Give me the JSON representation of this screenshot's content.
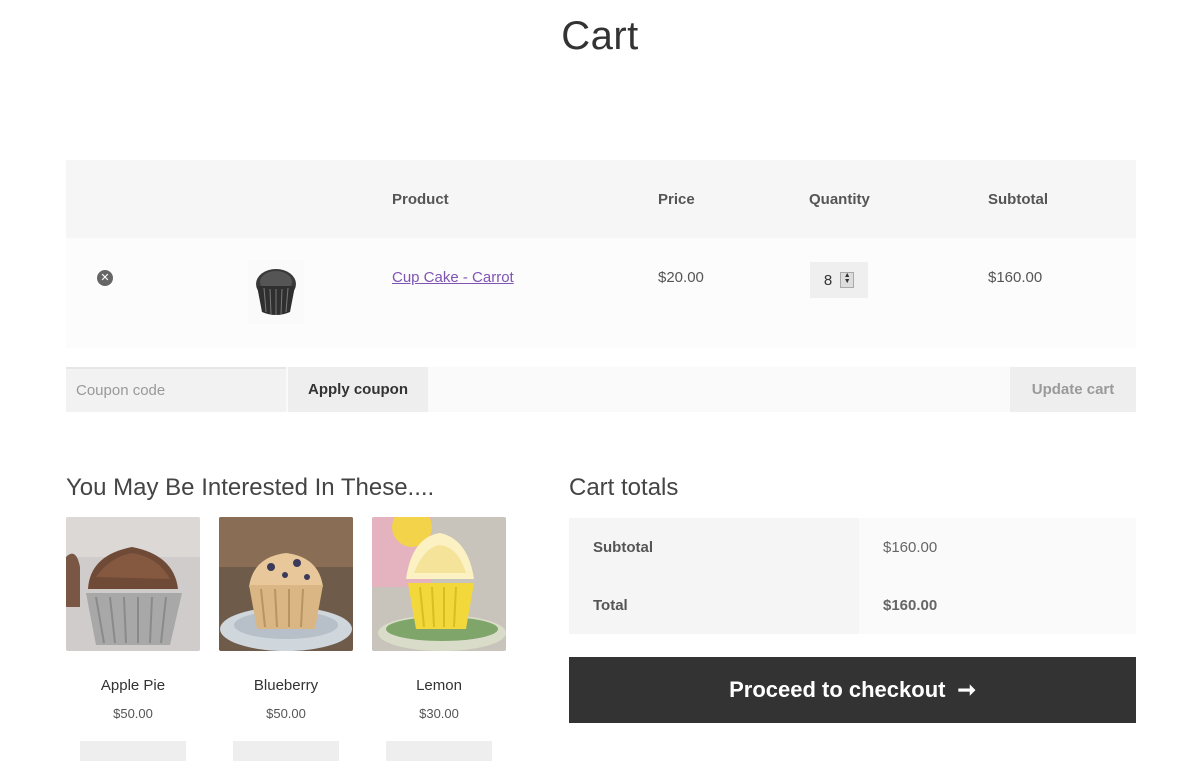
{
  "page": {
    "title": "Cart"
  },
  "cart_table": {
    "headers": {
      "product": "Product",
      "price": "Price",
      "quantity": "Quantity",
      "subtotal": "Subtotal"
    },
    "items": [
      {
        "name": "Cup Cake - Carrot",
        "price": "$20.00",
        "quantity": "8",
        "subtotal": "$160.00"
      }
    ]
  },
  "actions": {
    "coupon_placeholder": "Coupon code",
    "apply_coupon_label": "Apply coupon",
    "update_cart_label": "Update cart"
  },
  "cross_sells": {
    "title": "You May Be Interested In These....",
    "items": [
      {
        "name": "Apple Pie",
        "price": "$50.00"
      },
      {
        "name": "Blueberry",
        "price": "$50.00"
      },
      {
        "name": "Lemon",
        "price": "$30.00"
      }
    ]
  },
  "cart_totals": {
    "title": "Cart totals",
    "subtotal_label": "Subtotal",
    "subtotal_value": "$160.00",
    "total_label": "Total",
    "total_value": "$160.00",
    "checkout_label": "Proceed to checkout",
    "checkout_icon": "arrow-right-icon"
  },
  "colors": {
    "link": "#7f54b3",
    "checkout_bg": "#333333"
  }
}
